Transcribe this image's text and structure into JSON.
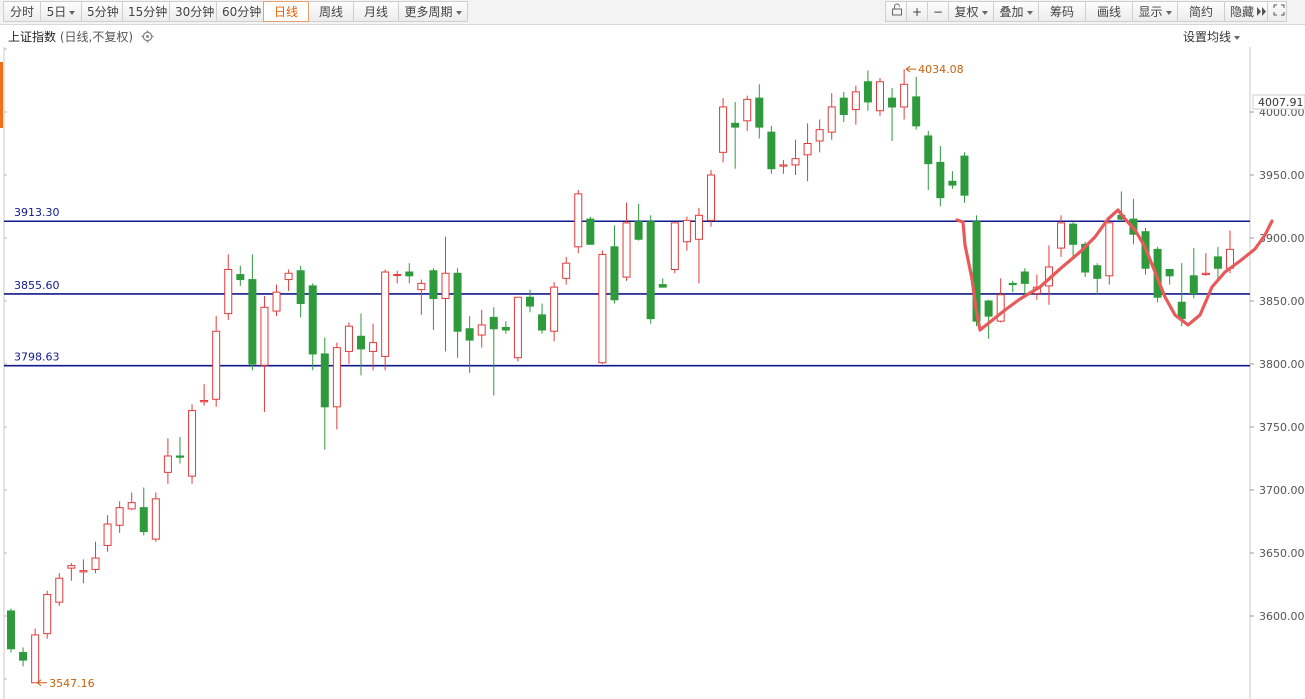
{
  "toolbar": {
    "periods": [
      {
        "label": "分时",
        "active": false,
        "dropdown": false,
        "width": 38
      },
      {
        "label": "5日",
        "active": false,
        "dropdown": true,
        "width": 42
      },
      {
        "label": "5分钟",
        "active": false,
        "dropdown": false,
        "width": 42
      },
      {
        "label": "15分钟",
        "active": false,
        "dropdown": false,
        "width": 48
      },
      {
        "label": "30分钟",
        "active": false,
        "dropdown": false,
        "width": 48
      },
      {
        "label": "60分钟",
        "active": false,
        "dropdown": false,
        "width": 48
      },
      {
        "label": "日线",
        "active": true,
        "dropdown": false,
        "width": 46
      },
      {
        "label": "周线",
        "active": false,
        "dropdown": false,
        "width": 46
      },
      {
        "label": "月线",
        "active": false,
        "dropdown": false,
        "width": 46
      },
      {
        "label": "更多周期",
        "active": false,
        "dropdown": true,
        "width": 70
      }
    ],
    "tools": [
      {
        "label": "",
        "icon": "lock-icon",
        "dropdown": false,
        "width": 22
      },
      {
        "label": "+",
        "icon": "zoom-in-icon",
        "dropdown": false,
        "width": 22
      },
      {
        "label": "−",
        "icon": "zoom-out-icon",
        "dropdown": false,
        "width": 22
      },
      {
        "label": "复权",
        "dropdown": true,
        "width": 46
      },
      {
        "label": "叠加",
        "dropdown": true,
        "width": 46
      },
      {
        "label": "筹码",
        "dropdown": false,
        "width": 48
      },
      {
        "label": "画线",
        "dropdown": false,
        "width": 48
      },
      {
        "label": "显示",
        "dropdown": true,
        "width": 46
      },
      {
        "label": "简约",
        "dropdown": false,
        "width": 48
      },
      {
        "label": "隐藏",
        "icon": "double-arrow-right-icon",
        "dropdown": false,
        "width": 44
      },
      {
        "label": "",
        "icon": "fullscreen-icon",
        "dropdown": false,
        "width": 20
      }
    ]
  },
  "header": {
    "title": "上证指数",
    "subtitle": "(日线,不复权)",
    "ma_setting": "设置均线"
  },
  "colors": {
    "up": "#e23b3b",
    "down": "#2e9a3c",
    "levels": "#111a8c",
    "annotation": "#e85a5a",
    "label_high_low": "#c8600a"
  },
  "chart_data": {
    "type": "candlestick",
    "title": "上证指数",
    "ylim": [
      3540,
      4045
    ],
    "y_ticks": [
      3600,
      3650,
      3700,
      3750,
      3800,
      3850,
      3900,
      3950,
      4000
    ],
    "y_tick_labels": [
      "3600.00",
      "3650.00",
      "3700.00",
      "3750.00",
      "3800.00",
      "3850.00",
      "3900.00",
      "3950.00",
      "4000.00"
    ],
    "current_value": "4007.91",
    "high_label": "4034.08",
    "low_label": "3547.16",
    "levels": [
      {
        "value": 3913.3,
        "label": "3913.30"
      },
      {
        "value": 3855.6,
        "label": "3855.60"
      },
      {
        "value": 3798.63,
        "label": "3798.63"
      }
    ],
    "candles": [
      [
        3604,
        3574,
        3606,
        3571
      ],
      [
        3571,
        3565,
        3575,
        3560
      ],
      [
        3547,
        3585,
        3590,
        3547
      ],
      [
        3586,
        3617,
        3620,
        3582
      ],
      [
        3611,
        3630,
        3634,
        3608
      ],
      [
        3638,
        3640,
        3642,
        3628
      ],
      [
        3635,
        3636,
        3645,
        3626
      ],
      [
        3637,
        3646,
        3659,
        3634
      ],
      [
        3656,
        3673,
        3680,
        3651
      ],
      [
        3672,
        3686,
        3691,
        3666
      ],
      [
        3685,
        3690,
        3698,
        3684
      ],
      [
        3686,
        3667,
        3702,
        3664
      ],
      [
        3661,
        3693,
        3698,
        3659
      ],
      [
        3714,
        3727,
        3741,
        3705
      ],
      [
        3727,
        3726,
        3742,
        3721
      ],
      [
        3711,
        3763,
        3768,
        3705
      ],
      [
        3770,
        3771,
        3784,
        3767
      ],
      [
        3772,
        3826,
        3838,
        3766
      ],
      [
        3840,
        3875,
        3887,
        3835
      ],
      [
        3871,
        3867,
        3878,
        3862
      ],
      [
        3867,
        3800,
        3887,
        3795
      ],
      [
        3799,
        3845,
        3854,
        3762
      ],
      [
        3842,
        3857,
        3863,
        3838
      ],
      [
        3867,
        3872,
        3875,
        3858
      ],
      [
        3874,
        3848,
        3878,
        3837
      ],
      [
        3862,
        3808,
        3864,
        3795
      ],
      [
        3808,
        3766,
        3821,
        3732
      ],
      [
        3766,
        3813,
        3817,
        3748
      ],
      [
        3810,
        3830,
        3833,
        3800
      ],
      [
        3822,
        3812,
        3840,
        3791
      ],
      [
        3810,
        3817,
        3832,
        3795
      ],
      [
        3806,
        3873,
        3875,
        3795
      ],
      [
        3871,
        3871,
        3874,
        3864
      ],
      [
        3873,
        3870,
        3880,
        3864
      ],
      [
        3859,
        3864,
        3867,
        3839
      ],
      [
        3874,
        3852,
        3876,
        3827
      ],
      [
        3852,
        3872,
        3901,
        3810
      ],
      [
        3872,
        3826,
        3876,
        3805
      ],
      [
        3828,
        3819,
        3838,
        3793
      ],
      [
        3823,
        3831,
        3843,
        3813
      ],
      [
        3837,
        3828,
        3845,
        3775
      ],
      [
        3829,
        3827,
        3834,
        3824
      ],
      [
        3805,
        3853,
        3853,
        3802
      ],
      [
        3853,
        3846,
        3859,
        3841
      ],
      [
        3839,
        3827,
        3848,
        3824
      ],
      [
        3826,
        3861,
        3865,
        3818
      ],
      [
        3868,
        3880,
        3885,
        3863
      ],
      [
        3893,
        3935,
        3938,
        3888
      ],
      [
        3915,
        3895,
        3917,
        3898
      ],
      [
        3801,
        3887,
        3890,
        3800
      ],
      [
        3893,
        3851,
        3910,
        3848
      ],
      [
        3869,
        3912,
        3928,
        3866
      ],
      [
        3913,
        3899,
        3927,
        3898
      ],
      [
        3913,
        3836,
        3918,
        3832
      ],
      [
        3863,
        3861,
        3868,
        3862
      ],
      [
        3875,
        3912,
        3912,
        3872
      ],
      [
        3897,
        3914,
        3917,
        3890
      ],
      [
        3899,
        3918,
        3924,
        3864
      ],
      [
        3914,
        3950,
        3954,
        3909
      ],
      [
        3968,
        4004,
        4011,
        3960
      ],
      [
        3991,
        3988,
        4008,
        3955
      ],
      [
        3993,
        4010,
        4013,
        3985
      ],
      [
        4011,
        3988,
        4022,
        3979
      ],
      [
        3984,
        3955,
        3989,
        3951
      ],
      [
        3957,
        3958,
        3962,
        3951
      ],
      [
        3958,
        3963,
        3978,
        3950
      ],
      [
        3966,
        3975,
        3991,
        3945
      ],
      [
        3977,
        3986,
        3994,
        3968
      ],
      [
        3984,
        4004,
        4015,
        3978
      ],
      [
        4011,
        3998,
        4016,
        3992
      ],
      [
        4002,
        4016,
        4021,
        3990
      ],
      [
        4024,
        4008,
        4033,
        4001
      ],
      [
        4001,
        4024,
        4027,
        3997
      ],
      [
        4011,
        4004,
        4019,
        3977
      ],
      [
        4004,
        4022,
        4034,
        3994
      ],
      [
        4012,
        3989,
        4028,
        3986
      ],
      [
        3981,
        3959,
        3985,
        3938
      ],
      [
        3960,
        3932,
        3973,
        3925
      ],
      [
        3945,
        3942,
        3953,
        3939
      ],
      [
        3965,
        3934,
        3968,
        3928
      ],
      [
        3913,
        3834,
        3918,
        3830
      ],
      [
        3850,
        3838,
        3851,
        3820
      ],
      [
        3834,
        3855,
        3868,
        3833
      ],
      [
        3864,
        3863,
        3866,
        3857
      ],
      [
        3873,
        3864,
        3876,
        3855
      ],
      [
        3856,
        3861,
        3871,
        3851
      ],
      [
        3862,
        3877,
        3894,
        3847
      ],
      [
        3892,
        3912,
        3918,
        3885
      ],
      [
        3911,
        3895,
        3913,
        3884
      ],
      [
        3895,
        3873,
        3897,
        3869
      ],
      [
        3878,
        3868,
        3880,
        3855
      ],
      [
        3870,
        3912,
        3915,
        3863
      ],
      [
        3918,
        3915,
        3937,
        3913
      ],
      [
        3915,
        3903,
        3931,
        3895
      ],
      [
        3905,
        3876,
        3908,
        3871
      ],
      [
        3891,
        3853,
        3893,
        3849
      ],
      [
        3875,
        3870,
        3875,
        3863
      ],
      [
        3849,
        3836,
        3880,
        3830
      ],
      [
        3870,
        3856,
        3892,
        3852
      ],
      [
        3871,
        3872,
        3888,
        3870
      ],
      [
        3885,
        3876,
        3893,
        3868
      ],
      [
        3876,
        3891,
        3906,
        3872
      ]
    ]
  }
}
